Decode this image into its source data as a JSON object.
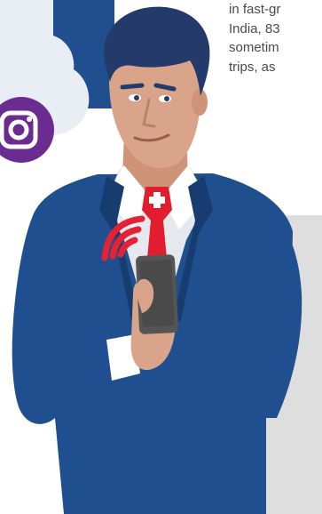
{
  "article": {
    "lines": [
      "in fast-gr",
      "India, 83",
      "sometim",
      "trips, as"
    ]
  },
  "colors": {
    "navy": "#23599a",
    "suit_blue": "#1f4f8f",
    "suit_dark": "#173d70",
    "cloud": "#e8edf3",
    "instagram_purple": "#6b2c91",
    "tie_red": "#e11d2f",
    "signal_red": "#e32235",
    "skin": "#d9a48a",
    "hair": "#233a6b",
    "phone": "#555555",
    "shadow_panel": "#dedede"
  },
  "icons": {
    "social": "instagram-icon",
    "signal": "wifi-signal-icon",
    "tie_emblem": "swiss-cross-icon"
  }
}
